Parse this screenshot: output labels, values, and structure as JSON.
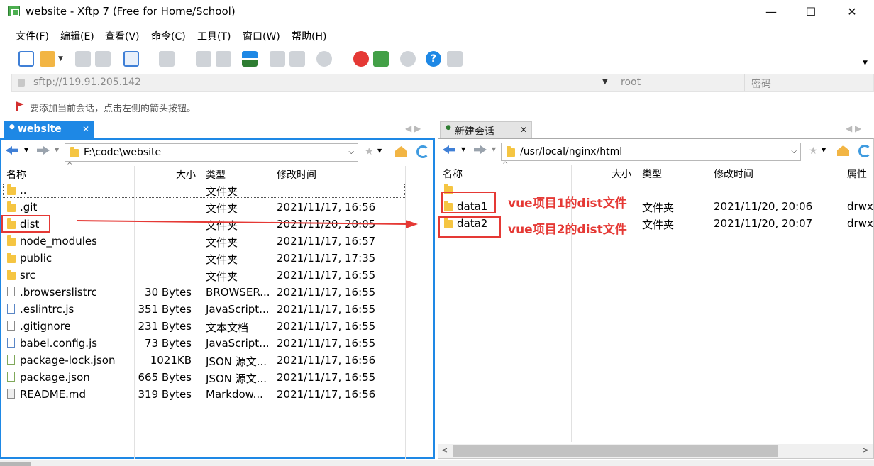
{
  "window": {
    "title": "website - Xftp 7 (Free for Home/School)",
    "minimize": "—",
    "maximize": "☐",
    "close": "✕"
  },
  "menu": [
    "文件(F)",
    "编辑(E)",
    "查看(V)",
    "命令(C)",
    "工具(T)",
    "窗口(W)",
    "帮助(H)"
  ],
  "address": {
    "host": "sftp://119.91.205.142",
    "user": "root",
    "password_placeholder": "密码"
  },
  "hint": "要添加当前会话，点击左侧的箭头按钮。",
  "left": {
    "tab": "website",
    "path": "F:\\code\\website",
    "columns": {
      "name": "名称",
      "size": "大小",
      "type": "类型",
      "modified": "修改时间"
    },
    "files": [
      {
        "name": "..",
        "size": "",
        "type": "文件夹",
        "modified": "",
        "icon": "folder-icon"
      },
      {
        "name": ".git",
        "size": "",
        "type": "文件夹",
        "modified": "2021/11/17, 16:56",
        "icon": "folder-icon"
      },
      {
        "name": "dist",
        "size": "",
        "type": "文件夹",
        "modified": "2021/11/20, 20:05",
        "icon": "folder-icon"
      },
      {
        "name": "node_modules",
        "size": "",
        "type": "文件夹",
        "modified": "2021/11/17, 16:57",
        "icon": "folder-icon"
      },
      {
        "name": "public",
        "size": "",
        "type": "文件夹",
        "modified": "2021/11/17, 17:35",
        "icon": "folder-icon"
      },
      {
        "name": "src",
        "size": "",
        "type": "文件夹",
        "modified": "2021/11/17, 16:55",
        "icon": "folder-icon"
      },
      {
        "name": ".browserslistrc",
        "size": "30 Bytes",
        "type": "BROWSER...",
        "modified": "2021/11/17, 16:55",
        "icon": "file-icon"
      },
      {
        "name": ".eslintrc.js",
        "size": "351 Bytes",
        "type": "JavaScript...",
        "modified": "2021/11/17, 16:55",
        "icon": "js-file-icon"
      },
      {
        "name": ".gitignore",
        "size": "231 Bytes",
        "type": "文本文档",
        "modified": "2021/11/17, 16:55",
        "icon": "text-file-icon"
      },
      {
        "name": "babel.config.js",
        "size": "73 Bytes",
        "type": "JavaScript...",
        "modified": "2021/11/17, 16:55",
        "icon": "js-file-icon"
      },
      {
        "name": "package-lock.json",
        "size": "1021KB",
        "type": "JSON 源文...",
        "modified": "2021/11/17, 16:56",
        "icon": "json-file-icon"
      },
      {
        "name": "package.json",
        "size": "665 Bytes",
        "type": "JSON 源文...",
        "modified": "2021/11/17, 16:55",
        "icon": "json-file-icon"
      },
      {
        "name": "README.md",
        "size": "319 Bytes",
        "type": "Markdow...",
        "modified": "2021/11/17, 16:56",
        "icon": "markdown-file-icon"
      }
    ]
  },
  "right": {
    "tab": "新建会话",
    "path": "/usr/local/nginx/html",
    "columns": {
      "name": "名称",
      "size": "大小",
      "type": "类型",
      "modified": "修改时间",
      "attr": "属性"
    },
    "files": [
      {
        "name": "",
        "size": "",
        "type": "",
        "modified": "",
        "attr": "",
        "icon": "folder-icon"
      },
      {
        "name": "data1",
        "size": "",
        "type": "文件夹",
        "modified": "2021/11/20, 20:06",
        "attr": "drwxr",
        "icon": "folder-icon"
      },
      {
        "name": "data2",
        "size": "",
        "type": "文件夹",
        "modified": "2021/11/20, 20:07",
        "attr": "drwxr",
        "icon": "folder-icon"
      }
    ]
  },
  "annotations": {
    "note1": "vue项目1的dist文件",
    "note2": "vue项目2的dist文件"
  },
  "colors": {
    "accent": "#1e88e5",
    "annotation": "#e53935",
    "folder": "#f5c542"
  }
}
